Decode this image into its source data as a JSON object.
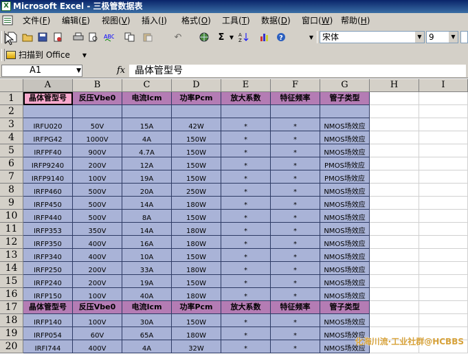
{
  "window": {
    "title": "Microsoft Excel - 三极管数据表",
    "app_icon": "X"
  },
  "menu": [
    "文件(F)",
    "编辑(E)",
    "视图(V)",
    "插入(I)",
    "格式(O)",
    "工具(T)",
    "数据(D)",
    "窗口(W)",
    "帮助(H)"
  ],
  "toolbar": {
    "font_name": "宋体",
    "font_size": "9",
    "scan_label": "扫描到 Office",
    "sigma": "Σ"
  },
  "formula_bar": {
    "name_box": "A1",
    "fx": "fx",
    "content": "晶体管型号"
  },
  "columns": [
    "A",
    "B",
    "C",
    "D",
    "E",
    "F",
    "G",
    "H",
    "I"
  ],
  "rows": [
    {
      "n": "1",
      "type": "header",
      "cells": [
        "晶体管型号",
        "反压Vbe0",
        "电流Icm",
        "功率Pcm",
        "放大系数",
        "特征频率",
        "管子类型"
      ]
    },
    {
      "n": "2",
      "type": "blank",
      "cells": [
        "",
        "",
        "",
        "",
        "",
        "",
        ""
      ]
    },
    {
      "n": "3",
      "type": "data",
      "cells": [
        "IRFU020",
        "50V",
        "15A",
        "42W",
        "*",
        "*",
        "NMOS场效应"
      ]
    },
    {
      "n": "4",
      "type": "data",
      "cells": [
        "IRFPG42",
        "1000V",
        "4A",
        "150W",
        "*",
        "*",
        "NMOS场效应"
      ]
    },
    {
      "n": "5",
      "type": "data",
      "cells": [
        "IRFPF40",
        "900V",
        "4.7A",
        "150W",
        "*",
        "*",
        "NMOS场效应"
      ]
    },
    {
      "n": "6",
      "type": "data",
      "cells": [
        "IRFP9240",
        "200V",
        "12A",
        "150W",
        "*",
        "*",
        "PMOS场效应"
      ]
    },
    {
      "n": "7",
      "type": "data",
      "cells": [
        "IRFP9140",
        "100V",
        "19A",
        "150W",
        "*",
        "*",
        "PMOS场效应"
      ]
    },
    {
      "n": "8",
      "type": "data",
      "cells": [
        "IRFP460",
        "500V",
        "20A",
        "250W",
        "*",
        "*",
        "NMOS场效应"
      ]
    },
    {
      "n": "9",
      "type": "data",
      "cells": [
        "IRFP450",
        "500V",
        "14A",
        "180W",
        "*",
        "*",
        "NMOS场效应"
      ]
    },
    {
      "n": "10",
      "type": "data",
      "cells": [
        "IRFP440",
        "500V",
        "8A",
        "150W",
        "*",
        "*",
        "NMOS场效应"
      ]
    },
    {
      "n": "11",
      "type": "data",
      "cells": [
        "IRFP353",
        "350V",
        "14A",
        "180W",
        "*",
        "*",
        "NMOS场效应"
      ]
    },
    {
      "n": "12",
      "type": "data",
      "cells": [
        "IRFP350",
        "400V",
        "16A",
        "180W",
        "*",
        "*",
        "NMOS场效应"
      ]
    },
    {
      "n": "13",
      "type": "data",
      "cells": [
        "IRFP340",
        "400V",
        "10A",
        "150W",
        "*",
        "*",
        "NMOS场效应"
      ]
    },
    {
      "n": "14",
      "type": "data",
      "cells": [
        "IRFP250",
        "200V",
        "33A",
        "180W",
        "*",
        "*",
        "NMOS场效应"
      ]
    },
    {
      "n": "15",
      "type": "data",
      "cells": [
        "IRFP240",
        "200V",
        "19A",
        "150W",
        "*",
        "*",
        "NMOS场效应"
      ]
    },
    {
      "n": "16",
      "type": "data",
      "cells": [
        "IRFP150",
        "100V",
        "40A",
        "180W",
        "*",
        "*",
        "NMOS场效应"
      ]
    },
    {
      "n": "17",
      "type": "header",
      "cells": [
        "晶体管型号",
        "反压Vbe0",
        "电流Icm",
        "功率Pcm",
        "放大系数",
        "特征频率",
        "管子类型"
      ]
    },
    {
      "n": "18",
      "type": "data",
      "cells": [
        "IRFP140",
        "100V",
        "30A",
        "150W",
        "*",
        "*",
        "NMOS场效应"
      ]
    },
    {
      "n": "19",
      "type": "data",
      "cells": [
        "IRFP054",
        "60V",
        "65A",
        "180W",
        "*",
        "*",
        "NMOS场效应"
      ]
    },
    {
      "n": "20",
      "type": "data",
      "cells": [
        "IRFI744",
        "400V",
        "4A",
        "32W",
        "*",
        "*",
        "NMOS场效应"
      ]
    }
  ],
  "watermark": "化海川流·工业社群@HCBBS",
  "colors": {
    "header_fill": "#b47cb4",
    "selected_header_fill": "#f8a8cc",
    "data_fill": "#a9b3d7",
    "title_bar": "#0a246a"
  }
}
